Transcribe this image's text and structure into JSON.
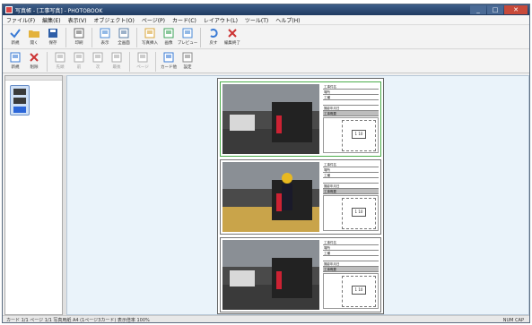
{
  "window": {
    "title": "写真帳 - [工事写真] - PHOTOBOOK",
    "controls": [
      "_",
      "□",
      "✕"
    ]
  },
  "menu": [
    "ファイル(F)",
    "編集(E)",
    "表示(V)",
    "オブジェクト(O)",
    "ページ(P)",
    "カード(C)",
    "レイアウト(L)",
    "ツール(T)",
    "ヘルプ(H)"
  ],
  "toolbar1": [
    {
      "label": "新規",
      "icon": "check-icon",
      "color": "#3a7bd5"
    },
    {
      "label": "開く",
      "icon": "folder-icon",
      "color": "#e3b23c"
    },
    {
      "label": "保存",
      "icon": "save-icon",
      "color": "#2f5fa7"
    },
    {
      "label": "印刷",
      "icon": "print-icon",
      "color": "#666666"
    },
    {
      "label": "表示",
      "icon": "view-icon",
      "color": "#4a8ad5"
    },
    {
      "label": "全画面",
      "icon": "fullscreen-icon",
      "color": "#5a7da5"
    },
    {
      "label": "写真挿入",
      "icon": "photo-icon",
      "color": "#d9a53a"
    },
    {
      "label": "画像",
      "icon": "image-icon",
      "color": "#3ea35a"
    },
    {
      "label": "プレビュー",
      "icon": "preview-icon",
      "color": "#4a8ad5"
    },
    {
      "label": "戻す",
      "icon": "undo-icon",
      "color": "#3a7bd5"
    },
    {
      "label": "編集終了",
      "icon": "close-x-icon",
      "color": "#cc3333"
    }
  ],
  "toolbar2": [
    {
      "label": "新規",
      "icon": "new-card-icon",
      "color": "#3a7bd5",
      "disabled": false
    },
    {
      "label": "削除",
      "icon": "delete-x-icon",
      "color": "#cc3333",
      "disabled": false
    },
    {
      "label": "先頭",
      "icon": "first-icon",
      "color": "#aaaaaa",
      "disabled": true
    },
    {
      "label": "前",
      "icon": "prev-icon",
      "color": "#aaaaaa",
      "disabled": true
    },
    {
      "label": "次",
      "icon": "next-icon",
      "color": "#aaaaaa",
      "disabled": true
    },
    {
      "label": "最後",
      "icon": "last-icon",
      "color": "#aaaaaa",
      "disabled": true
    },
    {
      "label": "ページ",
      "icon": "page-icon",
      "color": "#aaaaaa",
      "disabled": true
    },
    {
      "label": "カード他",
      "icon": "card-icon",
      "color": "#3a7bd5",
      "disabled": false
    },
    {
      "label": "設定",
      "icon": "settings-icon",
      "color": "#888888",
      "disabled": false
    }
  ],
  "cards": [
    {
      "rows": [
        "工事件名",
        "場所",
        "工種",
        "",
        "撮影年月日"
      ],
      "gray": "工事概要",
      "grid": "1 10"
    },
    {
      "rows": [
        "工事件名",
        "場所",
        "工種",
        "",
        "撮影年月日"
      ],
      "gray": "工事概要",
      "grid": "1 10"
    },
    {
      "rows": [
        "工事件名",
        "場所",
        "工種",
        "",
        "撮影年月日"
      ],
      "gray": "工事概要",
      "grid": "1 10"
    }
  ],
  "status": {
    "left": "カード 1/1  ページ 1/1  写真用紙 A4 (1ページ3カード)  表示倍率 100%",
    "right": "NUM  CAP"
  }
}
